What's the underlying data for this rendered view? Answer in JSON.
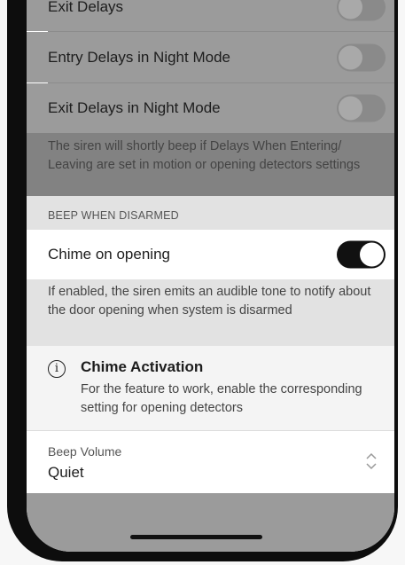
{
  "rows": {
    "exit_delays_label": "Exit Delays",
    "entry_night_label": "Entry Delays in Night Mode",
    "exit_night_label": "Exit Delays in Night Mode"
  },
  "delays_note": "The siren will shortly beep if Delays When Entering/ Leaving are set in motion or opening detectors settings",
  "beep_section": {
    "header": "BEEP WHEN DISARMED",
    "chime_label": "Chime on opening",
    "chime_enabled": true,
    "chime_note": "If enabled, the siren emits an audible tone to notify about the door opening when system is disarmed"
  },
  "info": {
    "icon": "info-icon",
    "title": "Chime Activation",
    "body": "For the feature to work, enable the corresponding setting for opening detectors"
  },
  "volume": {
    "label": "Beep Volume",
    "value": "Quiet",
    "icon": "chevron-updown-icon"
  },
  "colors": {
    "dimmed_background": "#9b9b9b",
    "toggle_on": "#111111"
  }
}
